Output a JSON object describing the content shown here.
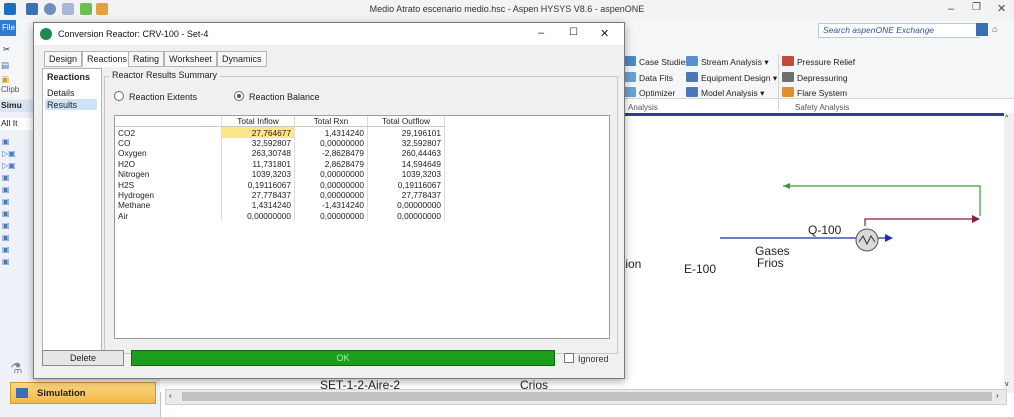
{
  "app": {
    "title": "Medio Atrato escenario medio.hsc - Aspen HYSYS V8.6 - aspenONE"
  },
  "ribbon": {
    "search_placeholder": "Search aspenONE Exchange",
    "file_tab": "File",
    "case_studies": "Case Studies",
    "data_fits": "Data Fits",
    "optimizer": "Optimizer",
    "analysis_group": "Analysis",
    "stream_analysis": "Stream Analysis",
    "equipment_design": "Equipment Design",
    "model_analysis": "Model Analysis",
    "pressure_relief": "Pressure Relief",
    "depressuring": "Depressuring",
    "flare_system": "Flare System",
    "safety_group": "Safety Analysis"
  },
  "left_pane": {
    "sim_tab": "Simulation",
    "clipboard_label": "Clipb",
    "sim_label": "Simu",
    "all_items": "All It"
  },
  "pfd": {
    "labels": {
      "tion": "tion",
      "e100": "E-100",
      "gases": "Gases",
      "frios": "Frios",
      "q100": "Q-100",
      "bottom_text": "SET-1-2-Aire-2",
      "bottom_text2": "Crios"
    },
    "colors": {
      "frame": "#2b3f8f",
      "stream_blue": "#1f2fa8",
      "stream_green": "#3a9a3a",
      "stream_maroon": "#8b1a4a"
    }
  },
  "dialog": {
    "title": "Conversion Reactor: CRV-100 - Set-4",
    "tabs": [
      "Design",
      "Reactions",
      "Rating",
      "Worksheet",
      "Dynamics"
    ],
    "active_tab": "Reactions",
    "nav": {
      "header": "Reactions",
      "items": [
        "Details",
        "Results"
      ],
      "selected": "Results"
    },
    "group_title": "Reactor Results Summary",
    "radio_extents": "Reaction Extents",
    "radio_balance": "Reaction Balance",
    "selected_radio": "Reaction Balance",
    "table": {
      "headers": [
        "",
        "Total Inflow",
        "Total Rxn",
        "Total Outflow"
      ],
      "rows": [
        [
          "CO2",
          "27,764677",
          "1,4314240",
          "29,196101"
        ],
        [
          "CO",
          "32,592807",
          "0,00000000",
          "32,592807"
        ],
        [
          "Oxygen",
          "263,30748",
          "-2,8628479",
          "260,44463"
        ],
        [
          "H2O",
          "11,731801",
          "2,8628479",
          "14,594649"
        ],
        [
          "Nitrogen",
          "1039,3203",
          "0,00000000",
          "1039,3203"
        ],
        [
          "H2S",
          "0,19116067",
          "0,00000000",
          "0,19116067"
        ],
        [
          "Hydrogen",
          "27,778437",
          "0,00000000",
          "27,778437"
        ],
        [
          "Methane",
          "1,4314240",
          "-1,4314240",
          "0,00000000"
        ],
        [
          "Air",
          "0,00000000",
          "0,00000000",
          "0,00000000"
        ]
      ]
    },
    "delete_label": "Delete",
    "status": "OK",
    "status_color": "#1c9e1c",
    "ignored_label": "Ignored"
  }
}
